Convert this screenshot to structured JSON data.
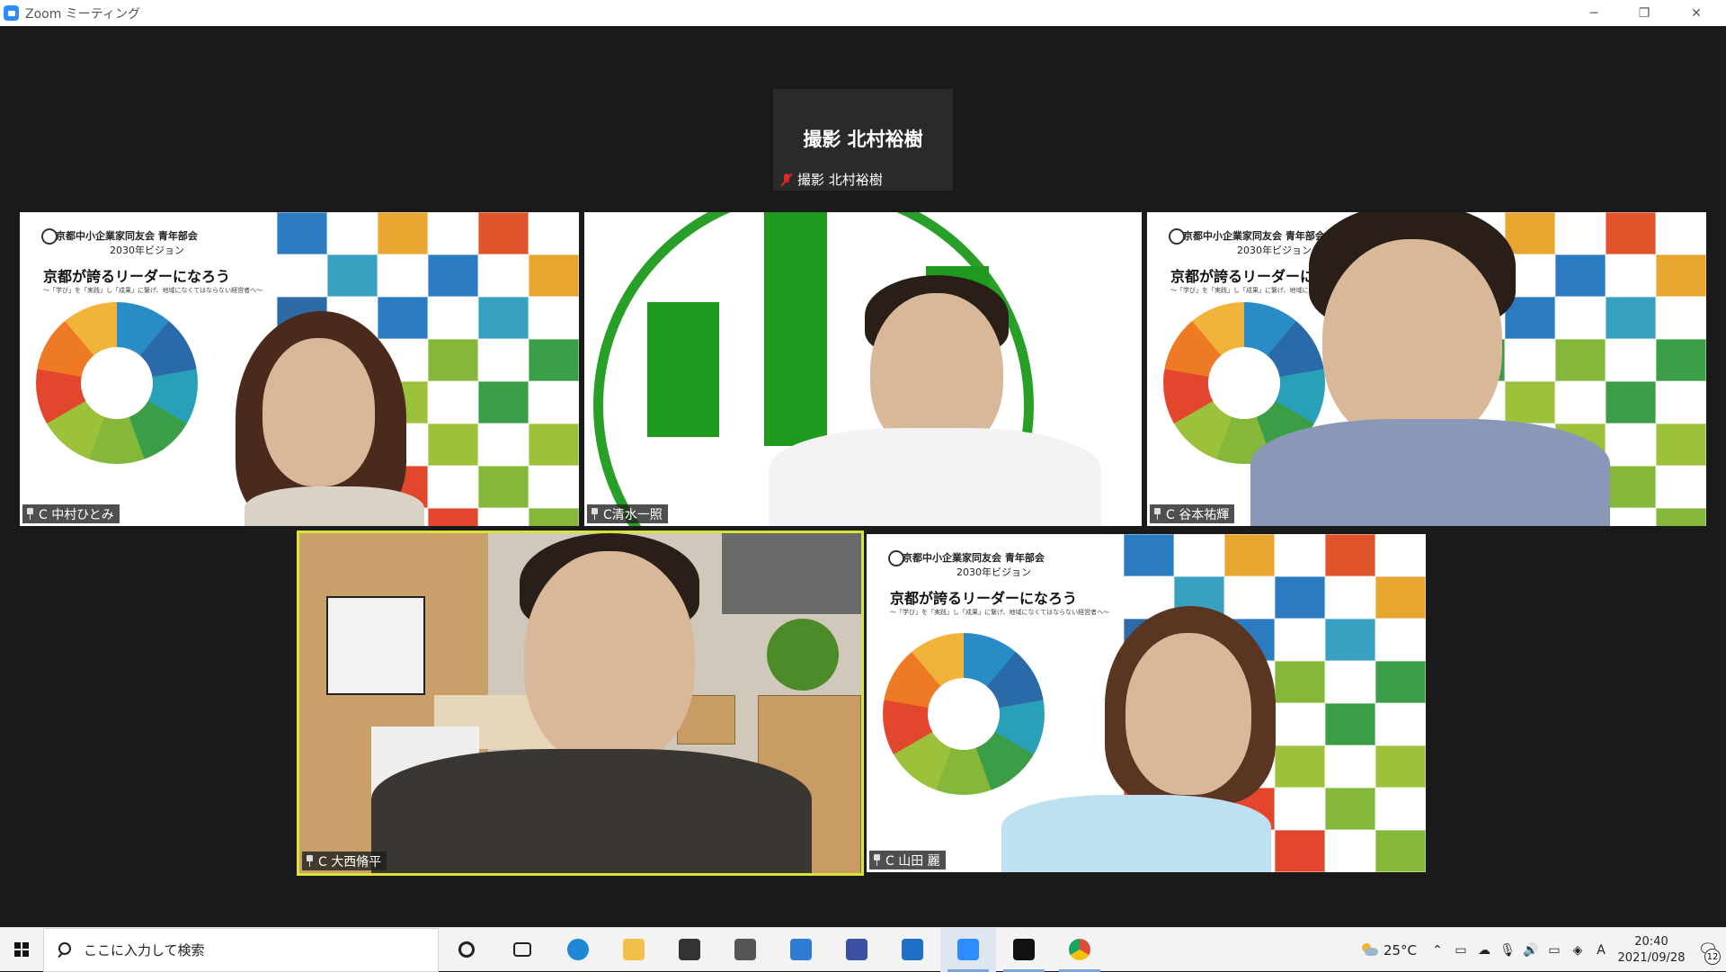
{
  "window": {
    "title": "Zoom ミーティング",
    "controls": {
      "minimize": "─",
      "restore": "❐",
      "close": "✕"
    }
  },
  "speaker": {
    "big_name": "撮影 北村裕樹",
    "label": "撮影 北村裕樹",
    "muted": true
  },
  "slide_text": {
    "org": "京都中小企業家同友会 青年部会",
    "vision": "2030年ビジョン",
    "headline": "京都が誇るリーダーになろう",
    "subline": "〜「学び」を「実践」し「成果」に繋げ、地域になくてはならない経営者へ〜"
  },
  "participants": [
    {
      "name": "C 中村ひとみ",
      "pinned": true,
      "background": "vision-slide"
    },
    {
      "name": "C清水一照",
      "pinned": true,
      "background": "green-logo"
    },
    {
      "name": "C 谷本祐輝",
      "pinned": true,
      "background": "vision-slide"
    },
    {
      "name": "C 大西脩平",
      "pinned": true,
      "background": "room",
      "active_speaker": true
    },
    {
      "name": "C 山田 麗",
      "pinned": true,
      "background": "vision-slide"
    }
  ],
  "taskbar": {
    "search_placeholder": "ここに入力して検索",
    "apps": [
      {
        "name": "cortana-icon",
        "color": "#222222"
      },
      {
        "name": "task-view-icon",
        "color": "#222222"
      },
      {
        "name": "edge-icon",
        "color": "#1e88d4"
      },
      {
        "name": "file-explorer-icon",
        "color": "#f2c14a"
      },
      {
        "name": "store-icon",
        "color": "#333333"
      },
      {
        "name": "app-icon",
        "color": "#555555"
      },
      {
        "name": "mail-icon",
        "color": "#2f7bd2"
      },
      {
        "name": "app-icon-2",
        "color": "#3b4fa3"
      },
      {
        "name": "calendar-icon",
        "color": "#1f6fc6"
      },
      {
        "name": "zoom-icon",
        "color": "#2d8cff"
      },
      {
        "name": "app-icon-3",
        "color": "#111111"
      },
      {
        "name": "chrome-icon",
        "color": "#de4b39"
      }
    ],
    "weather": "25°C",
    "tray_input": "A",
    "time": "20:40",
    "date": "2021/09/28",
    "notification_count": "12"
  }
}
